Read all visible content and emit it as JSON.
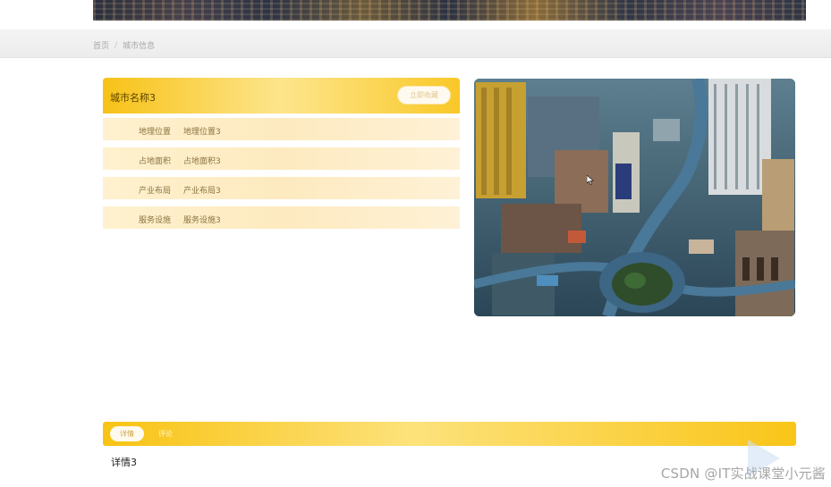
{
  "breadcrumb": {
    "home": "首页",
    "separator": "/",
    "current": "城市信息"
  },
  "city_card": {
    "title": "城市名称3",
    "button_label": "立即收藏",
    "rows": [
      {
        "label": "地理位置",
        "value": "地理位置3"
      },
      {
        "label": "占地面积",
        "value": "占地面积3"
      },
      {
        "label": "产业布局",
        "value": "产业布局3"
      },
      {
        "label": "服务设施",
        "value": "服务设施3"
      }
    ]
  },
  "tabs": {
    "active": "详情",
    "other": "评论"
  },
  "detail_text": "详情3",
  "watermark": "CSDN @IT实战课堂小元酱",
  "icons": {
    "cursor": "pointer-icon",
    "play": "play-icon"
  },
  "colors": {
    "accent": "#f8c313",
    "row_bg": "#fdeabf",
    "text": "#8a7440"
  }
}
